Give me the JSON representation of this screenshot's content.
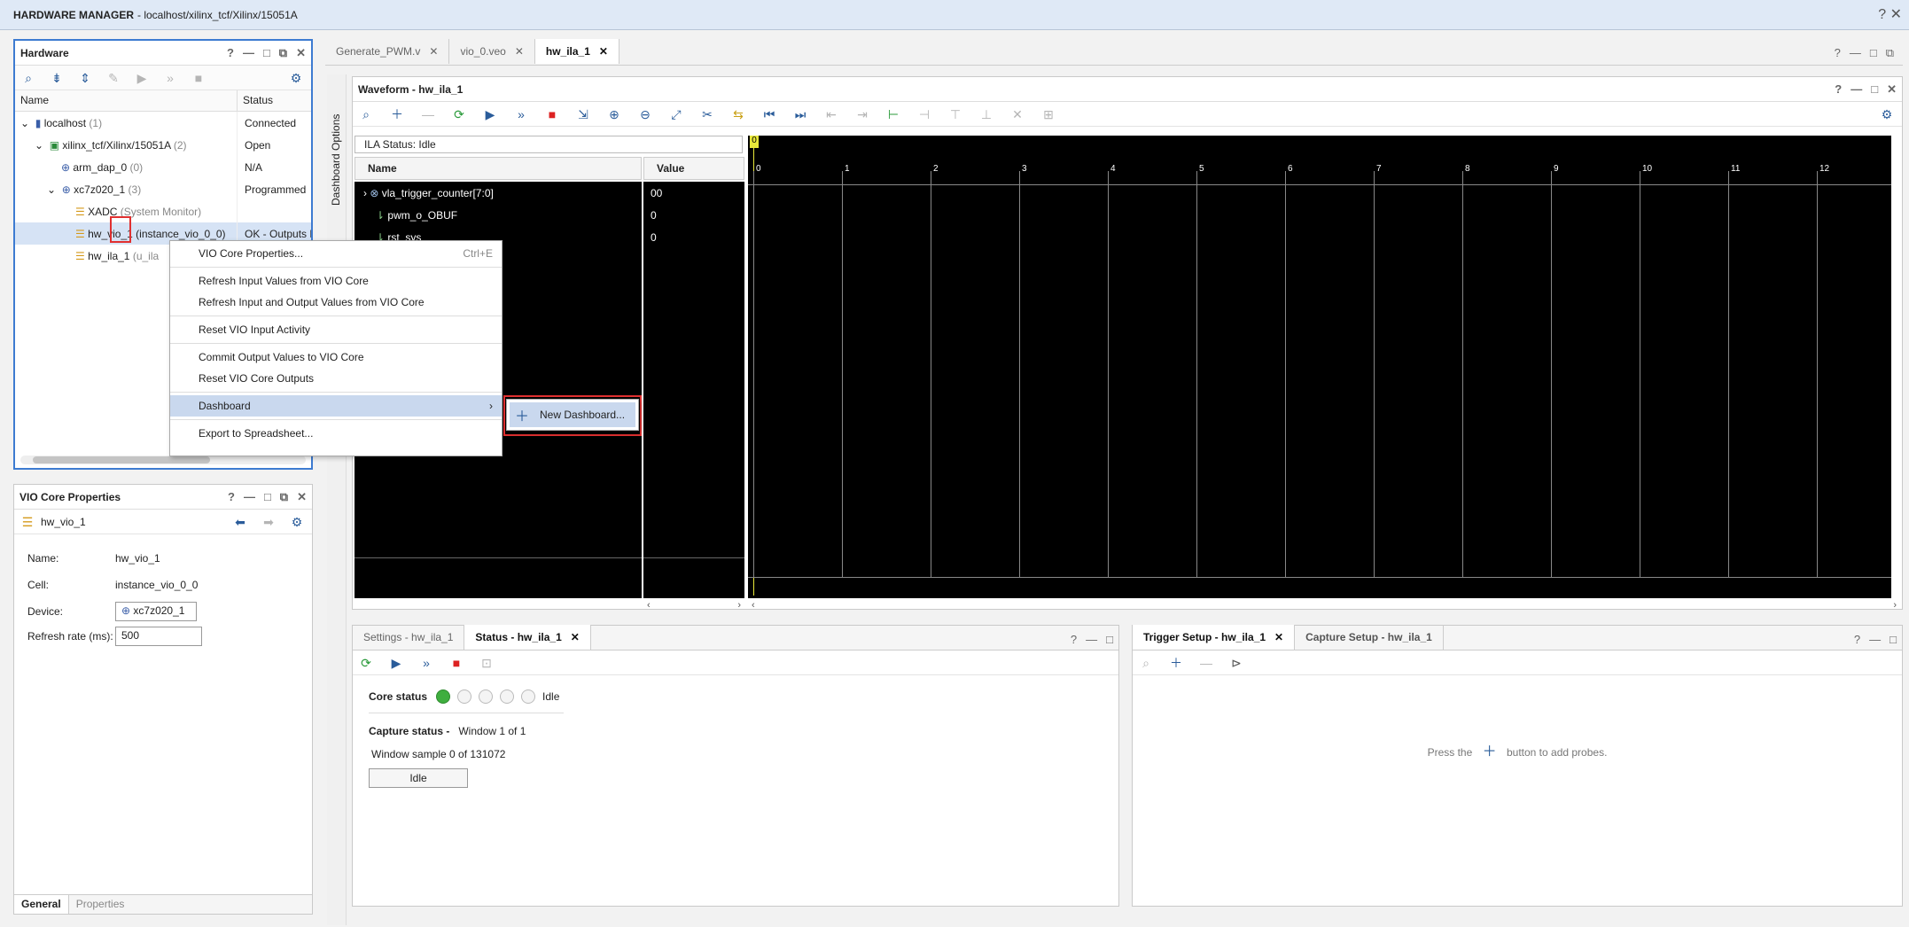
{
  "window": {
    "title_bold": "HARDWARE MANAGER",
    "title_rest": " - localhost/xilinx_tcf/Xilinx/15051A"
  },
  "hardware_panel": {
    "title": "Hardware",
    "col_name": "Name",
    "col_status": "Status",
    "rows": [
      {
        "label": "localhost",
        "extra": "(1)",
        "status": "Connected"
      },
      {
        "label": "xilinx_tcf/Xilinx/15051A",
        "extra": "(2)",
        "status": "Open"
      },
      {
        "label": "arm_dap_0",
        "extra": "(0)",
        "status": "N/A"
      },
      {
        "label": "xc7z020_1",
        "extra": "(3)",
        "status": "Programmed"
      },
      {
        "label": "XADC",
        "extra": "(System Monitor)",
        "status": ""
      },
      {
        "label": "hw_vio_1",
        "extra": "(instance_vio_0_0)",
        "status": "OK - Outputs R"
      },
      {
        "label": "hw_ila_1",
        "extra": "(u_ila",
        "status": ""
      }
    ]
  },
  "context_menu": {
    "items": [
      {
        "label": "VIO Core Properties...",
        "shortcut": "Ctrl+E"
      },
      {
        "label": "Refresh Input Values from VIO Core"
      },
      {
        "label": "Refresh Input and Output Values from VIO Core"
      },
      {
        "label": "Reset VIO Input Activity"
      },
      {
        "label": "Commit Output Values to VIO Core"
      },
      {
        "label": "Reset VIO Core Outputs"
      },
      {
        "label": "Dashboard"
      },
      {
        "label": "Export to Spreadsheet..."
      }
    ],
    "submenu_item": "New Dashboard..."
  },
  "vio_props": {
    "title": "VIO Core Properties",
    "object": "hw_vio_1",
    "name_label": "Name:",
    "name_value": "hw_vio_1",
    "cell_label": "Cell:",
    "cell_value": "instance_vio_0_0",
    "device_label": "Device:",
    "device_value": "xc7z020_1",
    "refresh_label": "Refresh rate (ms):",
    "refresh_value": "500",
    "tab_general": "General",
    "tab_properties": "Properties"
  },
  "editor_tabs": [
    "Generate_PWM.v",
    "vio_0.veo",
    "hw_ila_1"
  ],
  "side_label": "Dashboard Options",
  "waveform": {
    "title": "Waveform - hw_ila_1",
    "ila_status": "ILA Status:  Idle",
    "col_name": "Name",
    "col_value": "Value",
    "signals": [
      {
        "name": "vla_trigger_counter[7:0]",
        "value": "00"
      },
      {
        "name": "pwm_o_OBUF",
        "value": "0"
      },
      {
        "name": "rst_sys",
        "value": "0"
      }
    ],
    "ticks": [
      "0",
      "1",
      "2",
      "3",
      "4",
      "5",
      "6",
      "7",
      "8",
      "9",
      "10",
      "11",
      "12"
    ],
    "marker": "0"
  },
  "status_panel": {
    "tab1": "Settings - hw_ila_1",
    "tab2": "Status - hw_ila_1",
    "core_status_label": "Core status",
    "core_status_value": "Idle",
    "capture_status_label": "Capture status -",
    "capture_status_value": "Window 1 of 1",
    "window_sample": "Window sample 0 of 131072",
    "button": "Idle"
  },
  "trigger_panel": {
    "tab1": "Trigger Setup - hw_ila_1",
    "tab2": "Capture Setup - hw_ila_1",
    "hint_pre": "Press the",
    "hint_post": "button to add probes."
  }
}
